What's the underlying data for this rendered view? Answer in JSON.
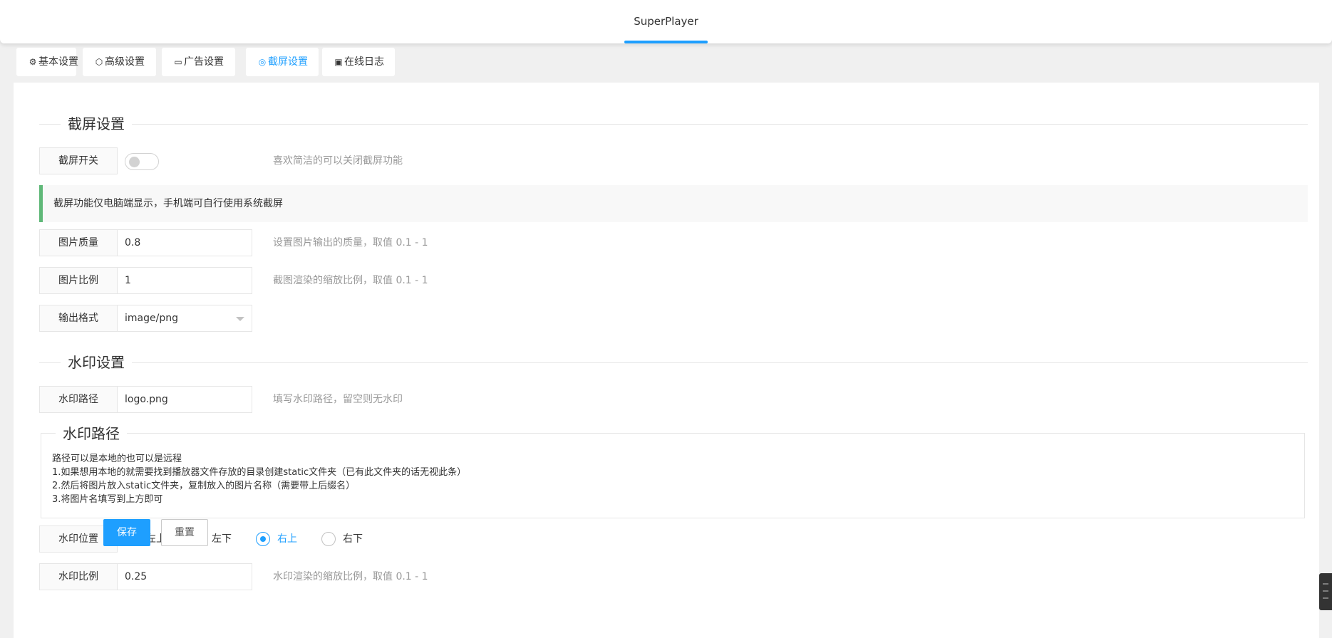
{
  "header": {
    "title": "SuperPlayer"
  },
  "tabs": [
    {
      "icon": "⚙",
      "label": "基本设置"
    },
    {
      "icon": "⬡",
      "label": "高级设置"
    },
    {
      "icon": "▭",
      "label": "广告设置"
    },
    {
      "icon": "◎",
      "label": "截屏设置",
      "active": true
    },
    {
      "icon": "▣",
      "label": "在线日志"
    }
  ],
  "screenshot": {
    "legend": "截屏设置",
    "switch_label": "截屏开关",
    "switch_on": false,
    "switch_hint": "喜欢简洁的可以关闭截屏功能",
    "notice": "截屏功能仅电脑端显示，手机端可自行使用系统截屏",
    "quality": {
      "label": "图片质量",
      "value": "0.8",
      "hint": "设置图片输出的质量，取值 0.1 - 1"
    },
    "scale": {
      "label": "图片比例",
      "value": "1",
      "hint": "截图渲染的缩放比例，取值 0.1 - 1"
    },
    "format": {
      "label": "输出格式",
      "value": "image/png"
    }
  },
  "watermark": {
    "legend": "水印设置",
    "path": {
      "label": "水印路径",
      "value": "logo.png",
      "hint": "填写水印路径，留空则无水印"
    },
    "info_title": "水印路径",
    "info_lines": [
      "路径可以是本地的也可以是远程",
      "1.如果想用本地的就需要找到播放器文件存放的目录创建static文件夹（已有此文件夹的话无视此条）",
      "2.然后将图片放入static文件夹，复制放入的图片名称（需要带上后缀名）",
      "3.将图片名填写到上方即可"
    ],
    "position": {
      "label": "水印位置",
      "options": [
        "左上",
        "左下",
        "右上",
        "右下"
      ],
      "selected": "右上"
    },
    "ratio": {
      "label": "水印比例",
      "value": "0.25",
      "hint": "水印渲染的缩放比例，取值 0.1 - 1"
    }
  },
  "buttons": {
    "save": "保存",
    "reset": "重置"
  },
  "colors": {
    "accent": "#1e9fff",
    "notice_border": "#5fb878"
  }
}
